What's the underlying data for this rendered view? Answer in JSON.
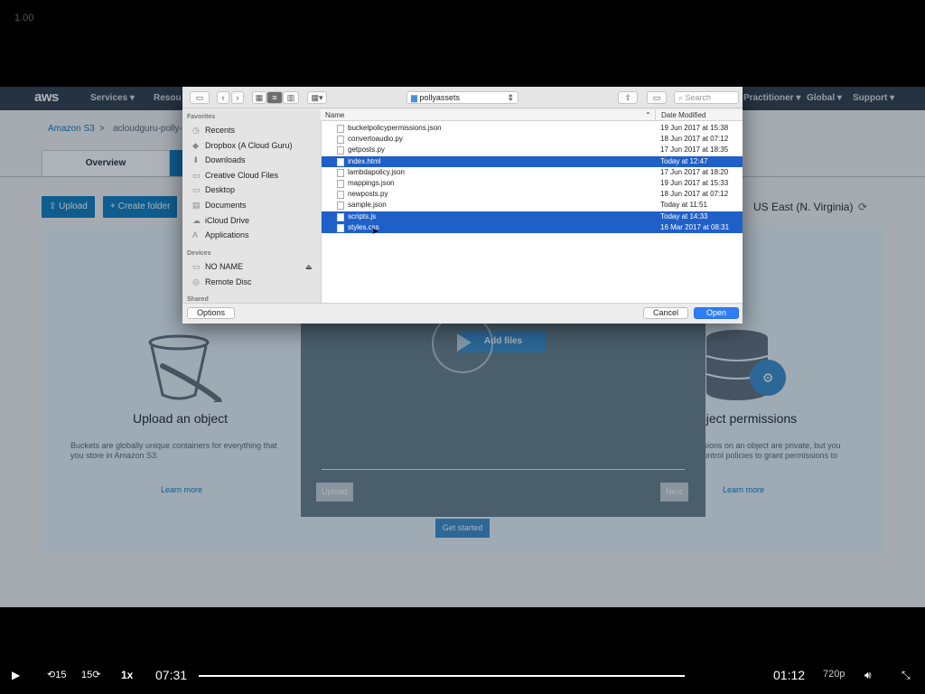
{
  "overlay": {
    "speed_indicator": "1.00"
  },
  "aws": {
    "logo": "aws",
    "nav": {
      "services": "Services ▾",
      "resources": "Resou",
      "practitioner": "Practitioner ▾",
      "global": "Global ▾",
      "support": "Support ▾"
    },
    "breadcrumb": {
      "s3": "Amazon S3",
      "sep": ">",
      "bucket": "acloudguru-polly-"
    },
    "tabs": {
      "overview": "Overview"
    },
    "buttons": {
      "upload": "Upload",
      "create_folder": "Create folder"
    },
    "region": "US East (N. Virginia)",
    "left_card": {
      "title": "Upload an object",
      "text": "Buckets are globally unique containers for everything that you store in Amazon S3.",
      "link": "Learn more"
    },
    "right_card": {
      "title": "bject permissions",
      "text": "ssions on an object are private, but you control policies to grant permissions to",
      "link": "Learn more"
    },
    "modal": {
      "add_files": "Add files",
      "upload": "Upload",
      "next": "Next",
      "get_started": "Get started"
    }
  },
  "dialog": {
    "path": "pollyassets",
    "search_placeholder": "Search",
    "sidebar": {
      "favorites_heading": "Favorites",
      "favorites": [
        {
          "label": "Recents",
          "icon": "clock-icon"
        },
        {
          "label": "Dropbox (A Cloud Guru)",
          "icon": "dropbox-icon"
        },
        {
          "label": "Downloads",
          "icon": "download-icon"
        },
        {
          "label": "Creative Cloud Files",
          "icon": "folder-icon"
        },
        {
          "label": "Desktop",
          "icon": "folder-icon"
        },
        {
          "label": "Documents",
          "icon": "document-icon"
        },
        {
          "label": "iCloud Drive",
          "icon": "cloud-icon"
        },
        {
          "label": "Applications",
          "icon": "applications-icon"
        }
      ],
      "devices_heading": "Devices",
      "devices": [
        {
          "label": "NO NAME",
          "icon": "drive-icon"
        },
        {
          "label": "Remote Disc",
          "icon": "disc-icon"
        }
      ],
      "shared_heading": "Shared",
      "eject": "⏏"
    },
    "columns": {
      "name": "Name",
      "date": "Date Modified"
    },
    "files": [
      {
        "name": "bucketpolicypermissions.json",
        "date": "19 Jun 2017 at 15:38",
        "selected": false
      },
      {
        "name": "convertoaudio.py",
        "date": "18 Jun 2017 at 07:12",
        "selected": false
      },
      {
        "name": "getposts.py",
        "date": "17 Jun 2017 at 18:35",
        "selected": false
      },
      {
        "name": "index.html",
        "date": "Today at 12:47",
        "selected": true
      },
      {
        "name": "lambdapolicy.json",
        "date": "17 Jun 2017 at 18:20",
        "selected": false
      },
      {
        "name": "mappings.json",
        "date": "19 Jun 2017 at 15:33",
        "selected": false
      },
      {
        "name": "newposts.py",
        "date": "18 Jun 2017 at 07:12",
        "selected": false
      },
      {
        "name": "sample.json",
        "date": "Today at 11:51",
        "selected": false
      },
      {
        "name": "scripts.js",
        "date": "Today at 14:33",
        "selected": true
      },
      {
        "name": "styles.css",
        "date": "16 Mar 2017 at 08:31",
        "selected": true
      }
    ],
    "buttons": {
      "options": "Options",
      "cancel": "Cancel",
      "open": "Open"
    }
  },
  "player": {
    "current_time": "07:31",
    "remaining_time": "01:12",
    "speed": "1x",
    "quality": "720p",
    "rewind_label": "15",
    "forward_label": "15",
    "progress_fraction": 1.0
  }
}
